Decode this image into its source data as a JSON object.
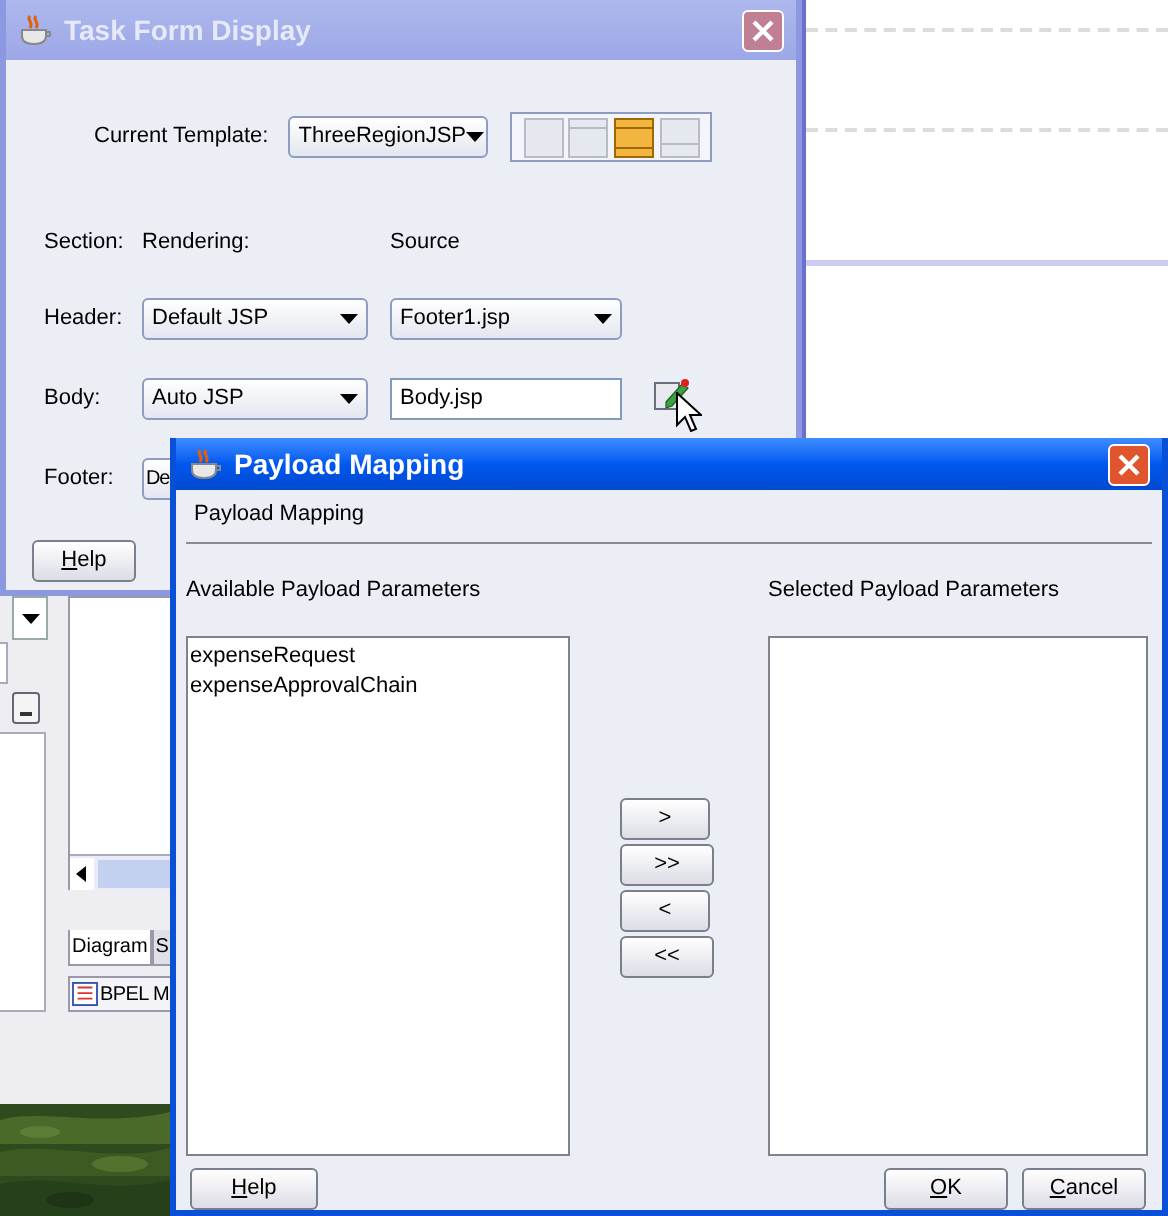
{
  "ide": {
    "tabs": [
      {
        "label": "Diagram",
        "selected": true
      },
      {
        "label": "S",
        "selected": false
      }
    ],
    "editor_tab": "BPEL M"
  },
  "task_form_window": {
    "title": "Task Form Display",
    "active": false,
    "template_label": "Current Template:",
    "template_value": "ThreeRegionJSP",
    "layouts": [
      {
        "kind": "single",
        "selected": false
      },
      {
        "kind": "header-body",
        "selected": false
      },
      {
        "kind": "three-region",
        "selected": true
      },
      {
        "kind": "body-footer",
        "selected": false
      }
    ],
    "columns": [
      "Section:",
      "Rendering:",
      "Source"
    ],
    "sections": [
      {
        "label": "Header:",
        "rendering": "Default JSP",
        "source": "Footer1.jsp",
        "kind": "dropdown"
      },
      {
        "label": "Body:",
        "rendering": "Auto JSP",
        "source": "Body.jsp",
        "kind": "field"
      },
      {
        "label": "Footer:",
        "rendering": "De",
        "kind": "cut"
      }
    ],
    "help_button": "Help"
  },
  "payload_window": {
    "title": "Payload Mapping",
    "active": true,
    "heading": "Payload Mapping",
    "available_label": "Available Payload Parameters",
    "available": [
      "expenseRequest",
      "expenseApprovalChain"
    ],
    "selected_label": "Selected Payload Parameters",
    "move_buttons": [
      ">",
      ">>",
      "<",
      "<<"
    ],
    "buttons": [
      {
        "label": "Help",
        "kind": "help"
      },
      {
        "label": "OK",
        "kind": "ok"
      },
      {
        "label": "Cancel",
        "kind": "cancel"
      }
    ]
  }
}
